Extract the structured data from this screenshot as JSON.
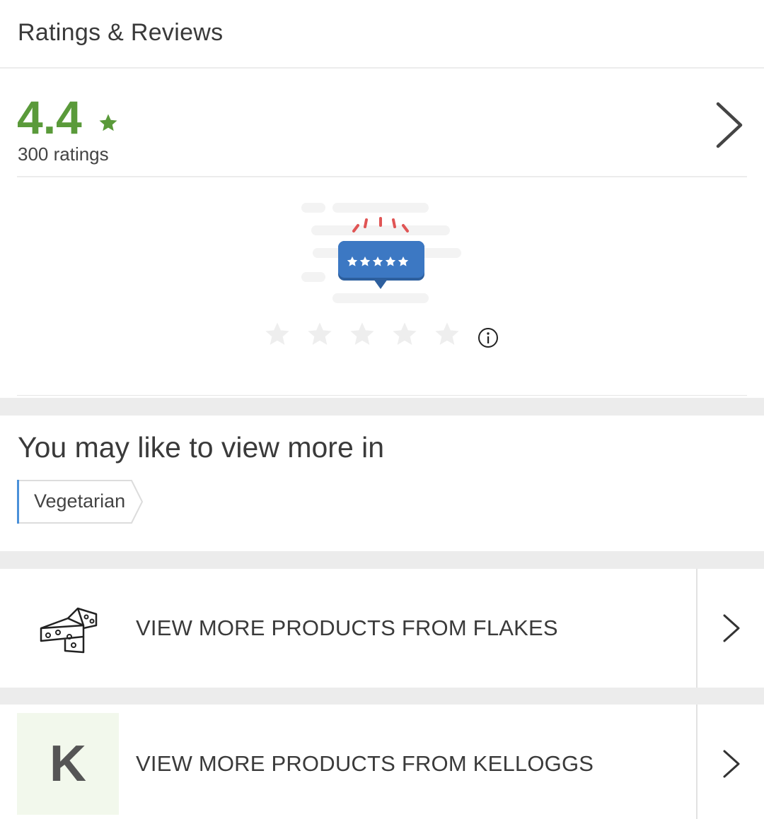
{
  "header": {
    "title": "Ratings & Reviews"
  },
  "rating": {
    "value": "4.4",
    "count_text": "300 ratings",
    "accent_color": "#5a9a3a",
    "user_stars_selected": 0,
    "user_stars_total": 5
  },
  "more": {
    "title": "You may like to view more in",
    "tags": [
      {
        "label": "Vegetarian"
      }
    ]
  },
  "brands": [
    {
      "label": "VIEW MORE PRODUCTS FROM FLAKES",
      "icon": "cheese-icon"
    },
    {
      "label": "VIEW MORE PRODUCTS FROM KELLOGGS",
      "logo_letter": "K"
    }
  ]
}
